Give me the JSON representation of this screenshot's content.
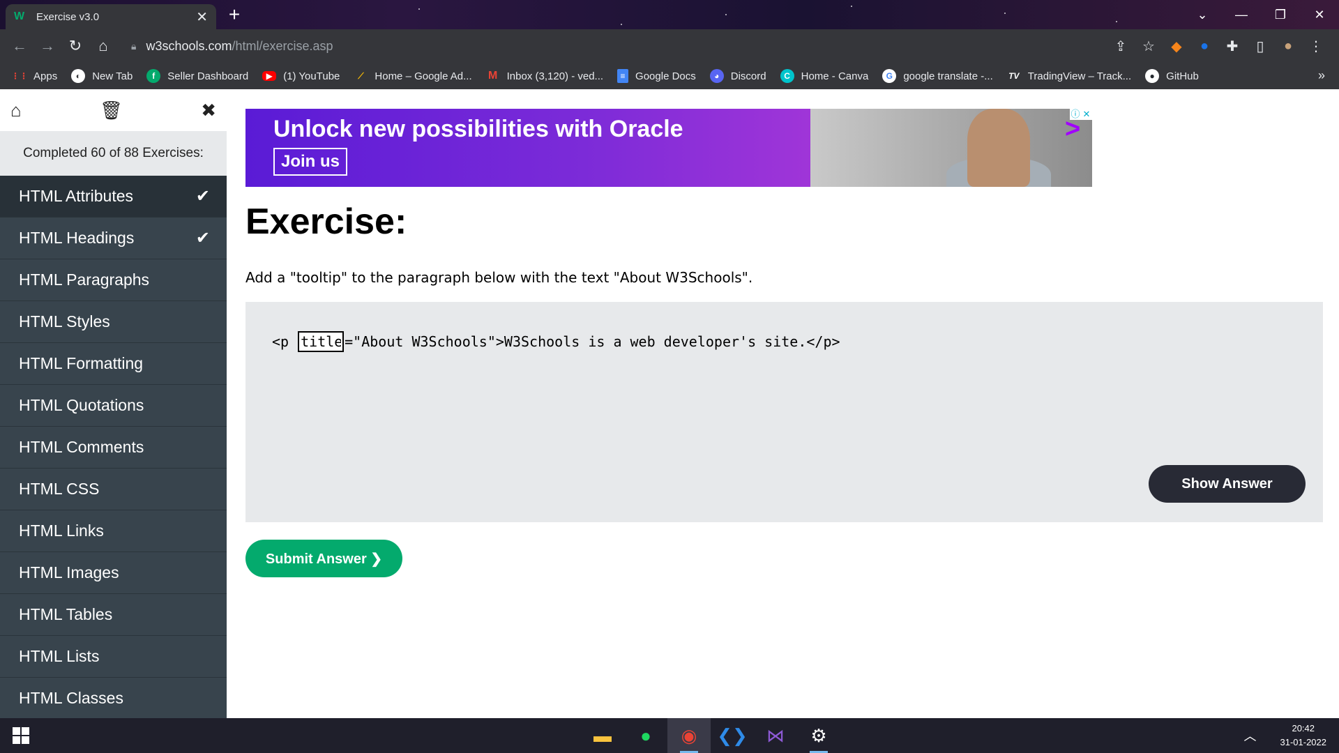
{
  "browser": {
    "tab_title": "Exercise v3.0",
    "url_host": "w3schools.com",
    "url_path": "/html/exercise.asp",
    "bookmarks": [
      {
        "label": "Apps",
        "icon": "apps-grid-icon",
        "color": "#ea4335"
      },
      {
        "label": "New Tab",
        "icon": "new-tab-icon",
        "color": "#ffffff"
      },
      {
        "label": "Seller Dashboard",
        "icon": "seller-dashboard-icon",
        "color": "#04aa6d"
      },
      {
        "label": "(1) YouTube",
        "icon": "youtube-icon",
        "color": "#ff0000"
      },
      {
        "label": "Home – Google Ad...",
        "icon": "google-ads-icon",
        "color": "#fbbc04"
      },
      {
        "label": "Inbox (3,120) - ved...",
        "icon": "gmail-icon",
        "color": "#ea4335"
      },
      {
        "label": "Google Docs",
        "icon": "google-docs-icon",
        "color": "#4285f4"
      },
      {
        "label": "Discord",
        "icon": "discord-icon",
        "color": "#5865f2"
      },
      {
        "label": "Home - Canva",
        "icon": "canva-icon",
        "color": "#00c4cc"
      },
      {
        "label": "google translate -...",
        "icon": "google-icon",
        "color": "#ffffff"
      },
      {
        "label": "TradingView – Track...",
        "icon": "tradingview-icon",
        "color": "#ffffff"
      },
      {
        "label": "GitHub",
        "icon": "github-icon",
        "color": "#ffffff"
      }
    ]
  },
  "sidebar": {
    "progress_text": "Completed 60 of 88 Exercises:",
    "chapters": [
      {
        "label": "HTML Attributes",
        "done": true
      },
      {
        "label": "HTML Headings",
        "done": true
      },
      {
        "label": "HTML Paragraphs",
        "done": false
      },
      {
        "label": "HTML Styles",
        "done": false
      },
      {
        "label": "HTML Formatting",
        "done": false
      },
      {
        "label": "HTML Quotations",
        "done": false
      },
      {
        "label": "HTML Comments",
        "done": false
      },
      {
        "label": "HTML CSS",
        "done": false
      },
      {
        "label": "HTML Links",
        "done": false
      },
      {
        "label": "HTML Images",
        "done": false
      },
      {
        "label": "HTML Tables",
        "done": false
      },
      {
        "label": "HTML Lists",
        "done": false
      },
      {
        "label": "HTML Classes",
        "done": false
      }
    ]
  },
  "ad": {
    "headline": "Unlock new possibilities with Oracle",
    "cta": "Join us"
  },
  "exercise": {
    "title": "Exercise:",
    "instructions": "Add a \"tooltip\" to the paragraph below with the text \"About W3Schools\".",
    "code_before": "<p ",
    "input_value": "title",
    "code_after": "=\"About W3Schools\">W3Schools is a web developer's site.</p>",
    "show_answer_label": "Show Answer",
    "submit_label": "Submit Answer ❯"
  },
  "taskbar": {
    "time": "20:42",
    "date": "31-01-2022"
  },
  "colors": {
    "w3_green": "#04aa6d",
    "sidebar_bg": "#38444d",
    "panel_bg": "#e7e9eb",
    "dark_button": "#282a35"
  }
}
